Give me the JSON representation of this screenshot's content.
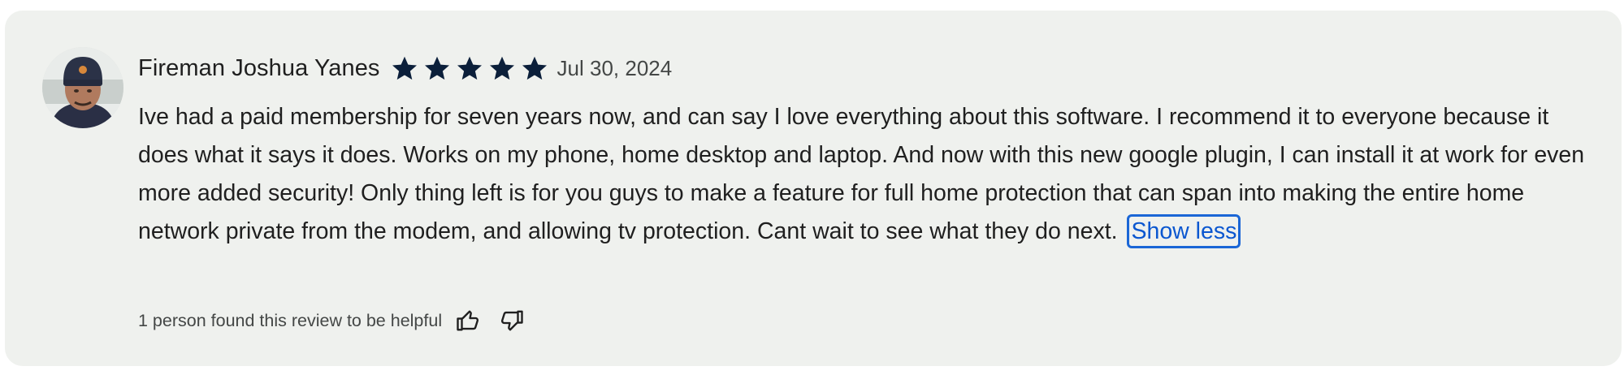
{
  "review": {
    "author": "Fireman Joshua Yanes",
    "rating": 5,
    "max_rating": 5,
    "date": "Jul 30, 2024",
    "text": "Ive had a paid membership for seven years now, and can say I love everything about this software. I recommend it to everyone because it does what it says it does. Works on my phone, home desktop and laptop. And now with this new google plugin, I can install it at work for even more added security! Only thing left is for you guys to make a feature for full home protection that can span into making the entire home network private from the modem, and allowing tv protection. Cant wait to see what they do next.",
    "show_less_label": "Show less",
    "helpful_text": "1 person found this review to be helpful",
    "thumbs_up_icon": "thumbs-up-icon",
    "thumbs_down_icon": "thumbs-down-icon",
    "avatar": "avatar"
  },
  "colors": {
    "card_bg": "#eff1ee",
    "star": "#0b1f3a",
    "link": "#0b57d0",
    "text": "#1f1f1f",
    "muted": "#444746"
  }
}
